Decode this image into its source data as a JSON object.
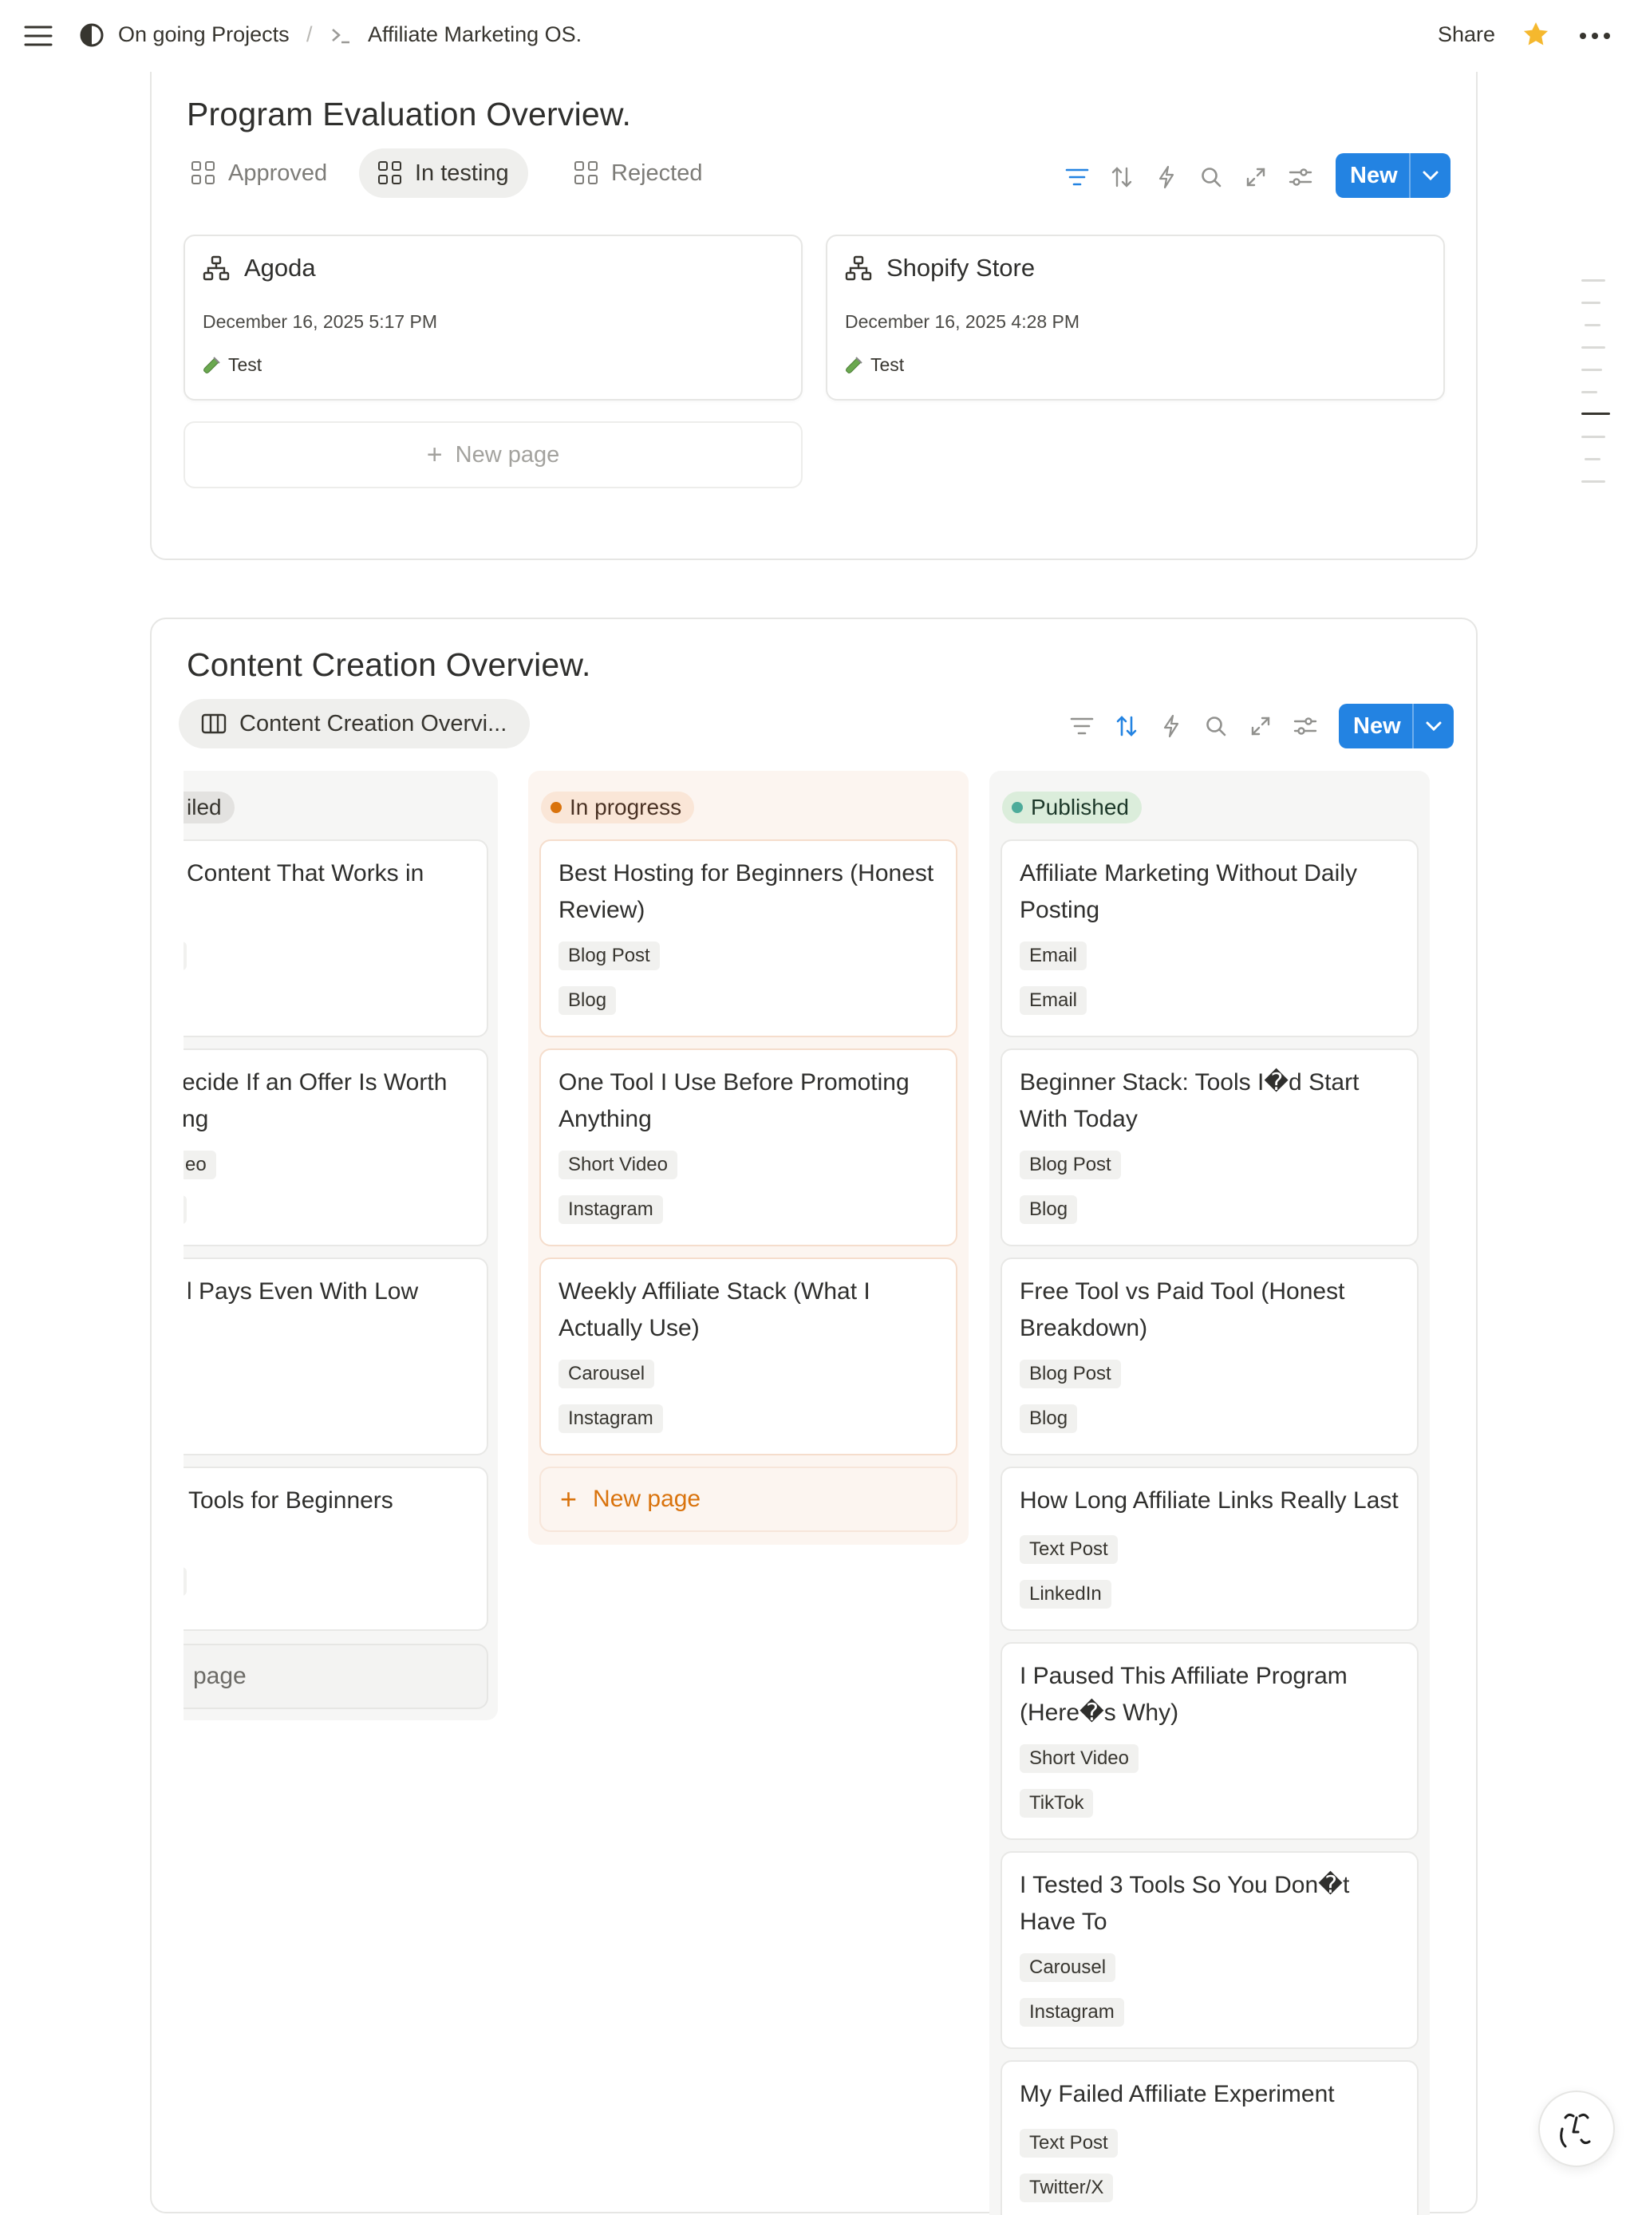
{
  "topbar": {
    "workspace": "On going Projects",
    "separator": "/",
    "page": "Affiliate Marketing OS.",
    "share": "Share"
  },
  "program_eval": {
    "title": "Program Evaluation Overview.",
    "tabs": [
      {
        "label": "Approved"
      },
      {
        "label": "In testing"
      },
      {
        "label": "Rejected"
      }
    ],
    "active_tab": "In testing",
    "new_label": "New",
    "cards": [
      {
        "title": "Agoda",
        "date": "December 16, 2025 5:17 PM",
        "status": "Test"
      },
      {
        "title": "Shopify Store",
        "date": "December 16, 2025 4:28 PM",
        "status": "Test"
      }
    ],
    "new_page": "New page"
  },
  "content_creation": {
    "title": "Content Creation Overview.",
    "view_tab": "Content Creation Overvi...",
    "new_label": "New",
    "columns": [
      {
        "status": "...led",
        "status_visible": "iled",
        "cards": [
          {
            "title": "Content That Works in",
            "tags": [
              "",
              ""
            ]
          },
          {
            "title": "ecide If an Offer Is Worth\nng",
            "tags": [
              "eo",
              ""
            ]
          },
          {
            "title": "l Pays Even With Low",
            "tags": []
          },
          {
            "title": "Tools for Beginners",
            "tags": [
              ""
            ]
          }
        ],
        "new_page": "page"
      },
      {
        "status": "In progress",
        "cards": [
          {
            "title": "Best Hosting for Beginners (Honest Review)",
            "tags": [
              "Blog Post",
              "Blog"
            ]
          },
          {
            "title": "One Tool I Use Before Promoting Anything",
            "tags": [
              "Short Video",
              "Instagram"
            ]
          },
          {
            "title": "Weekly Affiliate Stack (What I Actually Use)",
            "tags": [
              "Carousel",
              "Instagram"
            ]
          }
        ],
        "new_page": "New page"
      },
      {
        "status": "Published",
        "cards": [
          {
            "title": "Affiliate Marketing Without Daily Posting",
            "tags": [
              "Email",
              "Email"
            ]
          },
          {
            "title": "Beginner Stack: Tools I�d Start With Today",
            "tags": [
              "Blog Post",
              "Blog"
            ]
          },
          {
            "title": "Free Tool vs Paid Tool (Honest Breakdown)",
            "tags": [
              "Blog Post",
              "Blog"
            ]
          },
          {
            "title": "How Long Affiliate Links Really Last",
            "tags": [
              "Text Post",
              "LinkedIn"
            ]
          },
          {
            "title": "I Paused This Affiliate Program (Here�s Why)",
            "tags": [
              "Short Video",
              "TikTok"
            ]
          },
          {
            "title": "I Tested 3 Tools So You Don�t Have To",
            "tags": [
              "Carousel",
              "Instagram"
            ]
          },
          {
            "title": "My Failed Affiliate Experiment",
            "tags": [
              "Text Post",
              "Twitter/X"
            ]
          }
        ]
      }
    ]
  },
  "colors": {
    "accent": "#2383e2",
    "in_progress_bg": "#fcf5f0",
    "in_progress_pill": "#fae6d7",
    "in_progress_dot": "#d9730d",
    "published_bg": "#f6f6f5",
    "published_pill": "#dbeddb",
    "published_dot": "#4dab9a",
    "star": "#f5b82e"
  }
}
